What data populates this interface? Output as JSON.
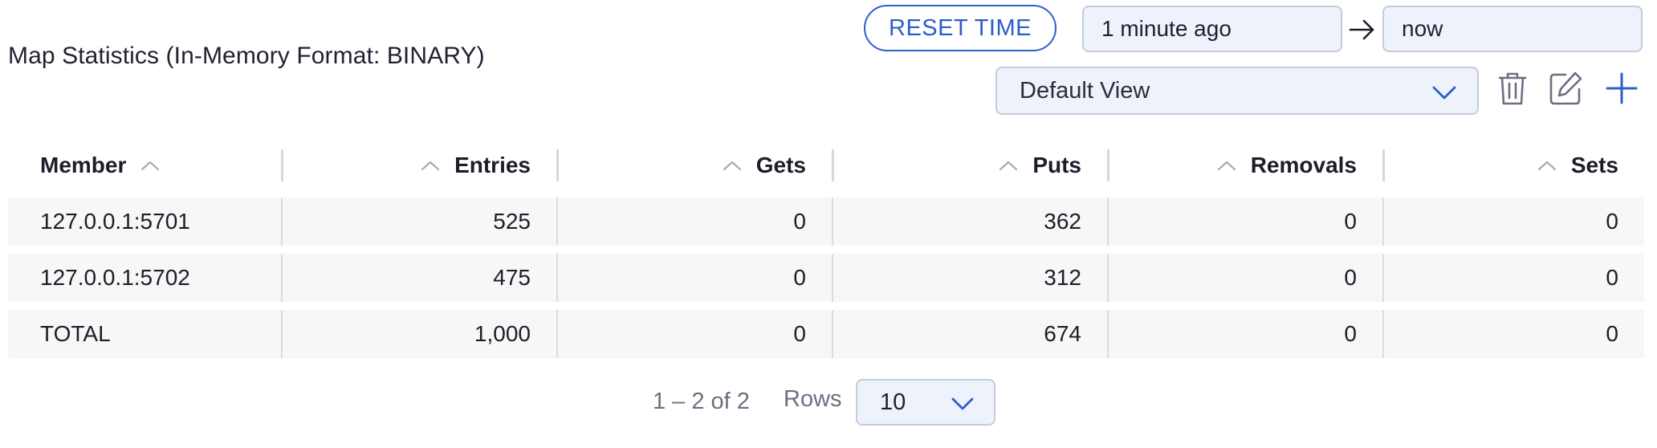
{
  "title": "Map Statistics (In-Memory Format: BINARY)",
  "time_range": {
    "reset_label": "RESET TIME",
    "from": "1 minute ago",
    "to": "now"
  },
  "view": {
    "selected": "Default View",
    "icons": [
      "trash-icon",
      "edit-icon",
      "plus-icon",
      "chevron-down-icon",
      "arrow-right-icon"
    ]
  },
  "table": {
    "columns": [
      "Member",
      "Entries",
      "Gets",
      "Puts",
      "Removals",
      "Sets"
    ],
    "rows": [
      [
        "127.0.0.1:5701",
        "525",
        "0",
        "362",
        "0",
        "0"
      ],
      [
        "127.0.0.1:5702",
        "475",
        "0",
        "312",
        "0",
        "0"
      ],
      [
        "TOTAL",
        "1,000",
        "0",
        "674",
        "0",
        "0"
      ]
    ]
  },
  "pagination": {
    "range_text": "1 – 2 of 2",
    "rows_label": "Rows",
    "rows_per_page": "10"
  },
  "colors": {
    "accent": "#2c5fcb",
    "field_bg": "#eef2fb",
    "row_bg": "#f7f7f7"
  }
}
